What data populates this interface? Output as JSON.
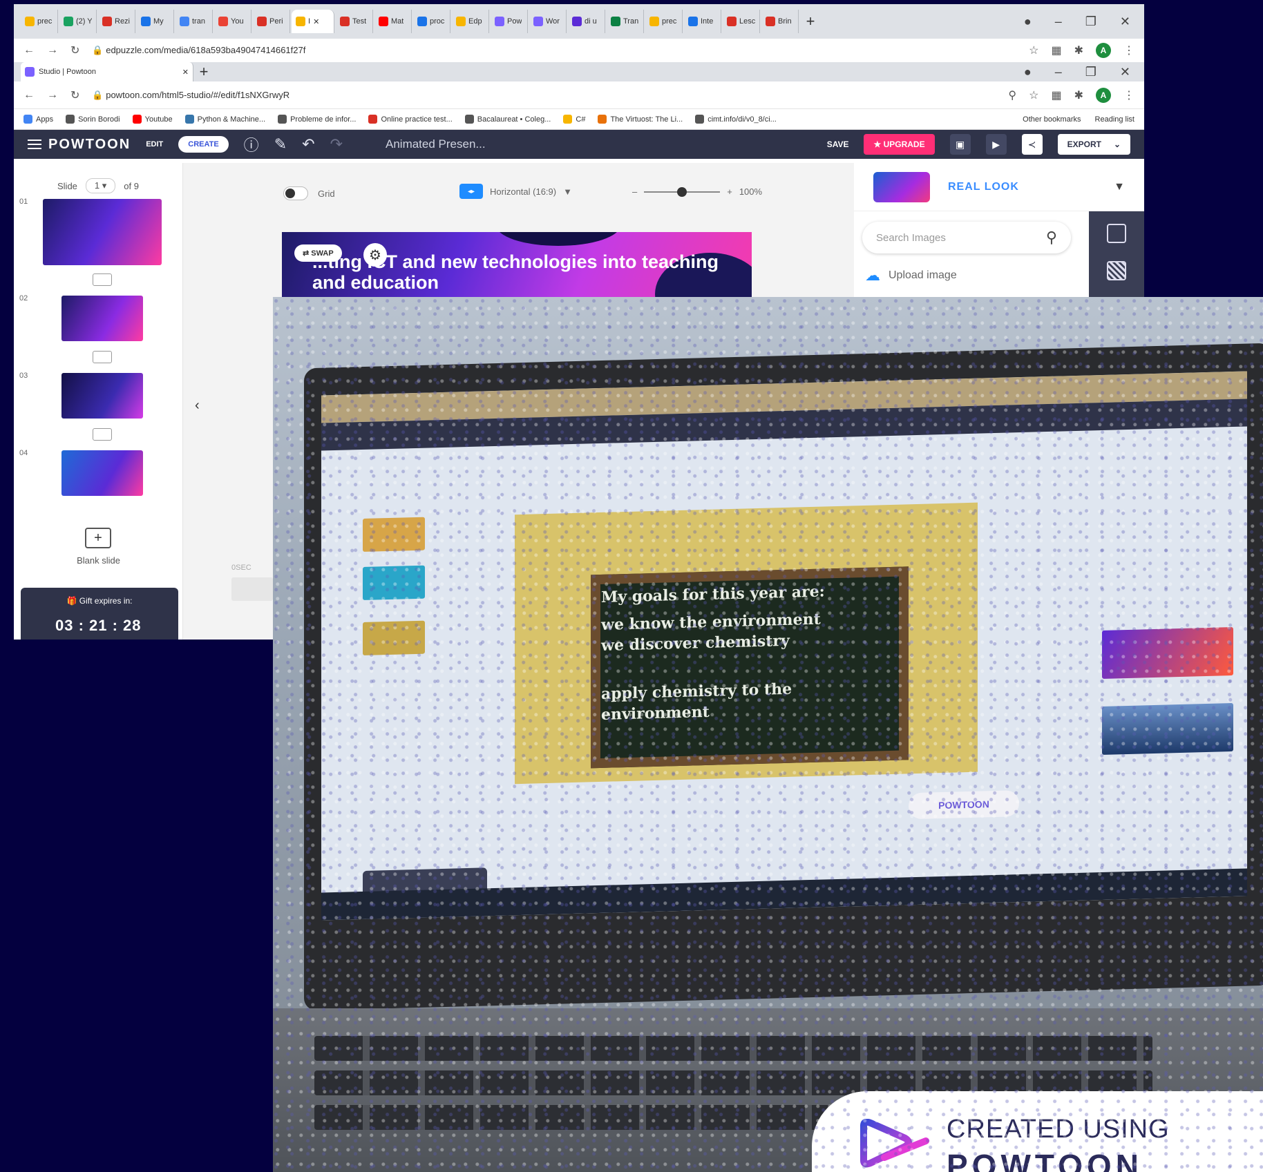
{
  "browser": {
    "tabs": [
      {
        "label": "prec",
        "color": "#f7b500"
      },
      {
        "label": "(2) Y",
        "color": "#1aa260"
      },
      {
        "label": "Rezi",
        "color": "#d93025"
      },
      {
        "label": "My",
        "color": "#1a73e8"
      },
      {
        "label": "tran",
        "color": "#4285f4"
      },
      {
        "label": "You",
        "color": "#ea4335"
      },
      {
        "label": "Peri",
        "color": "#d93025"
      },
      {
        "label": "I",
        "color": "#f7b500",
        "active": true
      },
      {
        "label": "Test",
        "color": "#d93025"
      },
      {
        "label": "Mat",
        "color": "#ff0000"
      },
      {
        "label": "proc",
        "color": "#1a73e8"
      },
      {
        "label": "Edp",
        "color": "#f7b500"
      },
      {
        "label": "Pow",
        "color": "#7b61ff"
      },
      {
        "label": "Wor",
        "color": "#7b61ff"
      },
      {
        "label": "di u",
        "color": "#5b2bd6"
      },
      {
        "label": "Tran",
        "color": "#0b8043"
      },
      {
        "label": "prec",
        "color": "#f7b500"
      },
      {
        "label": "Inte",
        "color": "#1a73e8"
      },
      {
        "label": "Lesc",
        "color": "#d93025"
      },
      {
        "label": "Brin",
        "color": "#d93025"
      }
    ],
    "url1": "edpuzzle.com/media/618a593ba49047414661f27f",
    "tab2_title": "Studio | Powtoon",
    "url2": "powtoon.com/html5-studio/#/edit/f1sNXGrwyR",
    "avatar": "A",
    "bookmarks": [
      {
        "label": "Apps",
        "color": "#4285f4"
      },
      {
        "label": "Sorin Borodi",
        "color": "#555555"
      },
      {
        "label": "Youtube",
        "color": "#ff0000"
      },
      {
        "label": "Python & Machine...",
        "color": "#3776ab"
      },
      {
        "label": "Probleme de infor...",
        "color": "#555555"
      },
      {
        "label": "Online practice test...",
        "color": "#d93025"
      },
      {
        "label": "Bacalaureat • Coleg...",
        "color": "#555555"
      },
      {
        "label": "C#",
        "color": "#f7b500"
      },
      {
        "label": "The Virtuost: The Li...",
        "color": "#e8710a"
      },
      {
        "label": "cimt.info/di/v0_8/ci...",
        "color": "#555555"
      }
    ],
    "bookmarks_right": [
      "Other bookmarks",
      "Reading list"
    ]
  },
  "powtoon": {
    "logo": "POWTOON",
    "edit": "EDIT",
    "create": "CREATE",
    "title": "Animated Presen...",
    "save": "SAVE",
    "upgrade": "UPGRADE",
    "export": "EXPORT",
    "slide_label": "Slide",
    "slide_current": "1",
    "slide_of": "of 9",
    "thumb_numbers": [
      "01",
      "02",
      "03",
      "04"
    ],
    "blank_slide": "Blank slide",
    "gift_label": "Gift expires in:",
    "gift_time": "03 : 21 : 28",
    "grid_label": "Grid",
    "orientation": "Horizontal (16:9)",
    "zoom_value": "100%",
    "slide_title": "...ting ICT and new technologies into teaching and education",
    "swap": "SWAP",
    "real_look": "REAL LOOK",
    "search_placeholder": "Search Images",
    "upload_image": "Upload image",
    "timeline_label": "0SEC"
  },
  "photo": {
    "chalk_lines": [
      "My goals for this year are:",
      "we know the environment",
      "we discover chemistry",
      "apply chemistry to the",
      "environment"
    ],
    "badge": "POWTOON"
  },
  "watermark": {
    "line1": "CREATED USING",
    "line2": "POWTOON"
  },
  "colors": {
    "background": "#04003f",
    "powtoon_bar": "#2f3349",
    "upgrade": "#ff2e76",
    "accent_blue": "#3a8dff"
  }
}
